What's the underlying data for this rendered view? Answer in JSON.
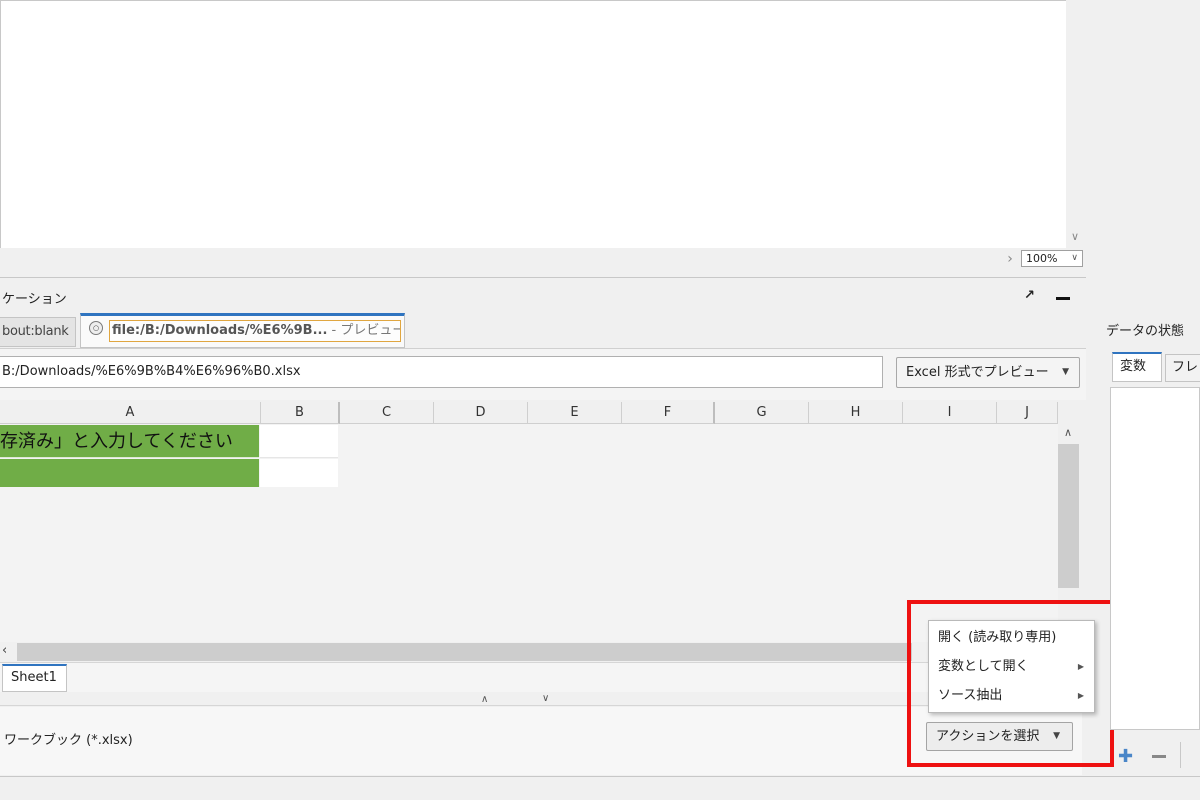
{
  "zoom": {
    "value": "100%"
  },
  "view": {
    "title": "ケーション"
  },
  "tabs": [
    {
      "label": "bout:blank"
    },
    {
      "label": "file:/B:/Downloads/%E6%9B...",
      "suffix": " - プレビュー"
    }
  ],
  "toolbar": {
    "path": "B:/Downloads/%E6%9B%B4%E6%96%B0.xlsx",
    "preview_format_label": "Excel 形式でプレビュー"
  },
  "sheet": {
    "columns": [
      "A",
      "B",
      "C",
      "D",
      "E",
      "F",
      "G",
      "H",
      "I",
      "J"
    ],
    "cell_a1": "存済み」と入力してください",
    "colors": {
      "fill_green": "#70ad47"
    },
    "tab_label": "Sheet1"
  },
  "bottom": {
    "file_type": "ワークブック (*.xlsx)",
    "action_button_label": "アクションを選択"
  },
  "context_menu": {
    "items": [
      {
        "label": "開く (読み取り専用)"
      },
      {
        "label": "変数として開く"
      },
      {
        "label": "ソース抽出"
      }
    ]
  },
  "side_panel": {
    "title": "データの状態",
    "tabs": [
      {
        "label": "変数"
      },
      {
        "label": "フレ"
      }
    ]
  },
  "highlight_color": "#ee1111"
}
